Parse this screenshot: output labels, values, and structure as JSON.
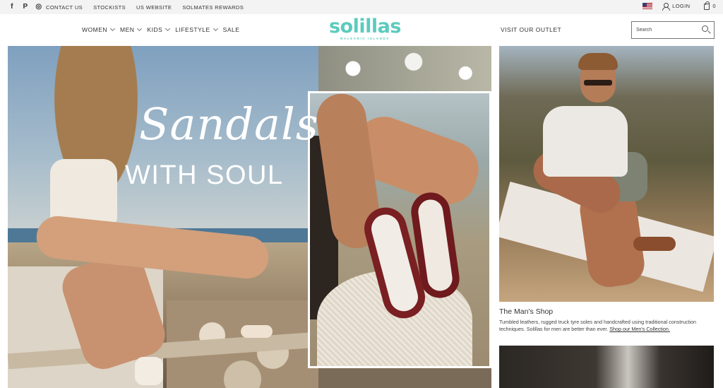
{
  "topbar": {
    "social": [
      {
        "icon": "facebook-icon",
        "glyph": "f"
      },
      {
        "icon": "pinterest-icon",
        "glyph": "P"
      },
      {
        "icon": "instagram-icon",
        "glyph": "◎"
      }
    ],
    "links": [
      "CONTACT US",
      "STOCKISTS",
      "US WEBSITE",
      "SOLMATES REWARDS"
    ],
    "login_label": "LOGIN",
    "cart_count": "0"
  },
  "header": {
    "nav": [
      "WOMEN",
      "MEN",
      "KIDS",
      "LIFESTYLE",
      "SALE"
    ],
    "logo_text": "solillas",
    "logo_sub": "BALEARIC ISLANDS",
    "outlet_label": "VISIT OUR OUTLET",
    "search_placeholder": "Search"
  },
  "hero": {
    "headline_script": "Sandals",
    "headline_sub": "WITH SOUL"
  },
  "mens_shop": {
    "title": "The Man's Shop",
    "description": "Tumbled leathers, rugged truck tyre soles and handcrafted using traditional construction techniques. Solillas for men are better than ever.",
    "link_text": "Shop our Men's Collection."
  },
  "colors": {
    "brand_teal": "#5ccbbd",
    "topbar_bg": "#f3f3f3",
    "sandal_red": "#7a1f22"
  }
}
